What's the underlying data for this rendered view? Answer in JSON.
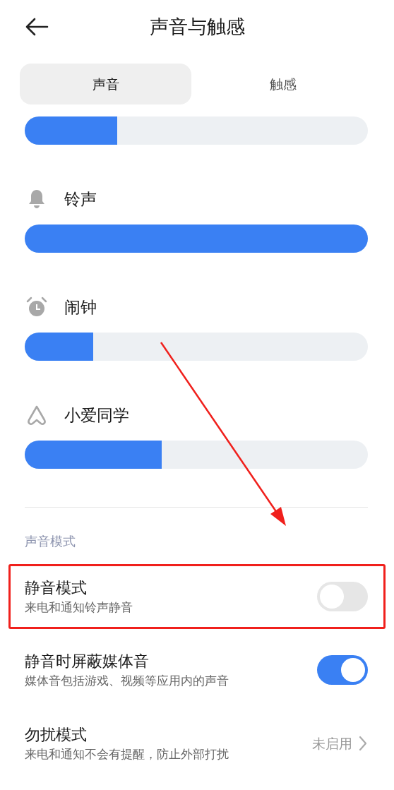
{
  "header": {
    "title": "声音与触感"
  },
  "tabs": [
    {
      "label": "声音",
      "selected": true
    },
    {
      "label": "触感",
      "selected": false
    }
  ],
  "volume_sliders": [
    {
      "kind": "unlabeled",
      "level": 0.27
    },
    {
      "kind": "ringtone",
      "label": "铃声",
      "level": 1
    },
    {
      "kind": "alarm",
      "label": "闹钟",
      "level": 0.2
    },
    {
      "kind": "assistant",
      "label": "小爱同学",
      "level": 0.4
    }
  ],
  "section_title": "声音模式",
  "settings": [
    {
      "kind": "toggle",
      "title": "静音模式",
      "subtitle": "来电和通知铃声静音",
      "on": false,
      "highlighted": true
    },
    {
      "kind": "toggle",
      "title": "静音时屏蔽媒体音",
      "subtitle": "媒体音包括游戏、视频等应用内的声音",
      "on": true,
      "highlighted": false
    },
    {
      "kind": "link",
      "title": "勿扰模式",
      "subtitle": "来电和通知不会有提醒，防止外部打扰",
      "value": "未启用",
      "highlighted": false
    }
  ],
  "annotations": [
    {
      "kind": "arrow"
    }
  ]
}
